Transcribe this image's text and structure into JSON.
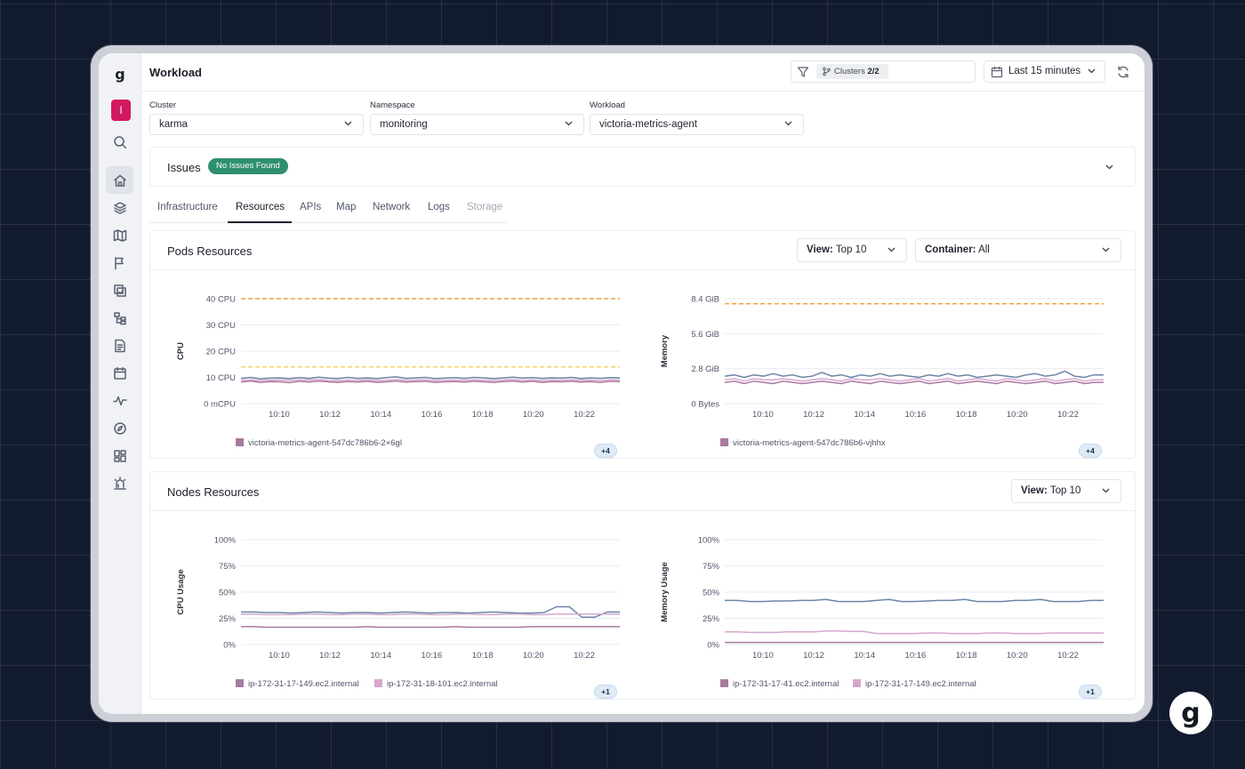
{
  "app": {
    "logo_letter": "g",
    "avatar_letter": "I"
  },
  "sidebar": {
    "icons": [
      "search-icon",
      "home-icon",
      "layers-icon",
      "map-icon",
      "flag-icon",
      "checklist-icon",
      "hierarchy-icon",
      "document-icon",
      "calendar-icon",
      "activity-icon",
      "compass-icon",
      "dashboard-icon",
      "alarm-icon"
    ],
    "active": "home-icon"
  },
  "header": {
    "title": "Workload",
    "clusters_label": "Clusters",
    "clusters_value": "2/2",
    "time_range": "Last 15 minutes"
  },
  "filters": {
    "cluster": {
      "label": "Cluster",
      "value": "karma"
    },
    "namespace": {
      "label": "Namespace",
      "value": "monitoring"
    },
    "workload": {
      "label": "Workload",
      "value": "victoria-metrics-agent"
    }
  },
  "issues": {
    "title": "Issues",
    "badge": "No Issues Found"
  },
  "tabs": [
    {
      "label": "Infrastructure",
      "state": "normal"
    },
    {
      "label": "Resources",
      "state": "active"
    },
    {
      "label": "APIs",
      "state": "normal"
    },
    {
      "label": "Map",
      "state": "normal"
    },
    {
      "label": "Network",
      "state": "normal"
    },
    {
      "label": "Logs",
      "state": "normal"
    },
    {
      "label": "Storage",
      "state": "disabled"
    }
  ],
  "pods_panel": {
    "title": "Pods Resources",
    "view_label": "View:",
    "view_value": "Top 10",
    "container_label": "Container:",
    "container_value": "All"
  },
  "nodes_panel": {
    "title": "Nodes Resources",
    "view_label": "View:",
    "view_value": "Top 10"
  },
  "colors": {
    "series_dark": "#6b86a8",
    "series_mauve": "#a87aa0",
    "series_pink": "#d7a7cf",
    "limit_orange": "#f0a040",
    "limit_yellow": "#f5cf5f",
    "badge_green": "#2e8f71"
  },
  "chart_data": [
    {
      "id": "pods-cpu",
      "type": "line",
      "ylabel": "CPU",
      "y_ticks": [
        "0 mCPU",
        "10 CPU",
        "20 CPU",
        "30 CPU",
        "40 CPU"
      ],
      "ylim": [
        0,
        40
      ],
      "x_ticks": [
        "10:10",
        "10:12",
        "10:14",
        "10:16",
        "10:18",
        "10:20",
        "10:22"
      ],
      "xlim": [
        0,
        14.9
      ],
      "limits": [
        {
          "value": 40,
          "color": "#f0a040"
        },
        {
          "value": 14,
          "color": "#f5cf5f"
        }
      ],
      "series": [
        {
          "color": "#6b86a8",
          "values": [
            9.6,
            10,
            9.4,
            9.7,
            9.8,
            9.5,
            9.9,
            9.6,
            10.1,
            9.7,
            9.5,
            10,
            9.6,
            9.8,
            9.5,
            9.9,
            10.2,
            9.6,
            9.8,
            10,
            9.5,
            9.7,
            9.9,
            9.6,
            10,
            9.8,
            9.5,
            9.8,
            10.1,
            9.7,
            9.9,
            9.6,
            9.8,
            9.7,
            10,
            9.5,
            9.8,
            9.6,
            9.9,
            9.8
          ]
        },
        {
          "color": "#a87aa0",
          "values": [
            8.2,
            8.6,
            8.1,
            8.4,
            8.3,
            8,
            8.5,
            8.2,
            8.6,
            8.3,
            8.1,
            8.4,
            8.2,
            8.5,
            8.1,
            8.3,
            8.6,
            8.2,
            8.4,
            8.5,
            8.1,
            8.3,
            8.4,
            8.2,
            8.5,
            8.3,
            8.1,
            8.4,
            8.6,
            8.2,
            8.5,
            8.1,
            8.4,
            8.3,
            8.5,
            8.2,
            8.4,
            8.1,
            8.5,
            8.4
          ]
        },
        {
          "color": "#d7a7cf",
          "values": [
            8.8,
            9.1,
            8.7,
            8.9,
            9,
            8.8,
            9.1,
            8.9,
            9.2,
            8.8,
            8.7,
            9,
            8.8,
            9.1,
            8.7,
            8.9,
            9.2,
            8.8,
            9,
            9.1,
            8.7,
            8.9,
            9,
            8.8,
            9.1,
            8.9,
            8.7,
            9,
            9.2,
            8.8,
            9.1,
            8.7,
            9,
            8.9,
            9.1,
            8.8,
            9,
            8.7,
            9.1,
            9
          ]
        }
      ],
      "legend": [
        "victoria-metrics-agent-547dc786b6-2×6gl"
      ],
      "more": "+4"
    },
    {
      "id": "pods-memory",
      "type": "line",
      "ylabel": "Memory",
      "y_ticks": [
        "0 Bytes",
        "2.8 GiB",
        "5.6 GiB",
        "8.4 GiB"
      ],
      "ylim": [
        0,
        8.4
      ],
      "x_ticks": [
        "10:10",
        "10:12",
        "10:14",
        "10:16",
        "10:18",
        "10:20",
        "10:22"
      ],
      "xlim": [
        0,
        14.9
      ],
      "limits": [
        {
          "value": 8.0,
          "color": "#f0a040"
        }
      ],
      "series": [
        {
          "color": "#6b86a8",
          "values": [
            2.2,
            2.3,
            2.1,
            2.3,
            2.2,
            2.4,
            2.2,
            2.3,
            2.1,
            2.2,
            2.5,
            2.2,
            2.3,
            2.1,
            2.3,
            2.2,
            2.4,
            2.2,
            2.3,
            2.2,
            2.1,
            2.3,
            2.2,
            2.4,
            2.2,
            2.3,
            2.1,
            2.2,
            2.3,
            2.2,
            2.1,
            2.3,
            2.4,
            2.2,
            2.3,
            2.6,
            2.2,
            2.1,
            2.3,
            2.3
          ]
        },
        {
          "color": "#a87aa0",
          "values": [
            1.7,
            1.8,
            1.6,
            1.8,
            1.7,
            1.6,
            1.8,
            1.7,
            1.6,
            1.7,
            1.8,
            1.7,
            1.6,
            1.8,
            1.7,
            1.6,
            1.8,
            1.7,
            1.6,
            1.7,
            1.8,
            1.6,
            1.7,
            1.8,
            1.6,
            1.7,
            1.8,
            1.7,
            1.6,
            1.8,
            1.7,
            1.6,
            1.7,
            1.8,
            1.6,
            1.7,
            1.8,
            1.6,
            1.7,
            1.7
          ]
        },
        {
          "color": "#d7a7cf",
          "values": [
            1.9,
            2,
            1.8,
            2,
            1.9,
            1.9,
            2,
            1.9,
            1.8,
            1.9,
            2,
            1.9,
            1.8,
            2,
            1.9,
            1.9,
            2,
            1.9,
            1.8,
            1.9,
            2,
            1.8,
            1.9,
            2,
            1.8,
            1.9,
            2,
            1.9,
            1.8,
            2,
            1.9,
            1.8,
            1.9,
            2,
            1.8,
            1.9,
            2,
            1.8,
            1.9,
            1.9
          ]
        }
      ],
      "legend": [
        "victoria-metrics-agent-547dc786b6-vjhhx"
      ],
      "more": "+4"
    },
    {
      "id": "nodes-cpu",
      "type": "line",
      "ylabel": "CPU Usage",
      "y_ticks": [
        "0%",
        "25%",
        "50%",
        "75%",
        "100%"
      ],
      "ylim": [
        0,
        100
      ],
      "x_ticks": [
        "10:10",
        "10:12",
        "10:14",
        "10:16",
        "10:18",
        "10:20",
        "10:22"
      ],
      "xlim": [
        0,
        14.9
      ],
      "limits": [],
      "series": [
        {
          "color": "#6b86a8",
          "values": [
            31,
            31,
            30.5,
            30.5,
            30,
            30.5,
            31,
            30.5,
            30,
            30.5,
            30.5,
            30,
            30.5,
            31,
            30.5,
            30,
            30.5,
            30.5,
            30,
            30.5,
            31,
            30.5,
            30,
            30,
            30.5,
            36,
            36,
            26,
            26,
            31,
            31
          ]
        },
        {
          "color": "#d7a7cf",
          "values": [
            29,
            29,
            28.5,
            28.5,
            28.5,
            29,
            29,
            28.5,
            28.5,
            29,
            29,
            28.5,
            28.5,
            29,
            29,
            28.5,
            28.5,
            29,
            29,
            28.5,
            28.5,
            29,
            29,
            28.5,
            28.5,
            29,
            29,
            29,
            29,
            29,
            29
          ]
        },
        {
          "color": "#a87aa0",
          "values": [
            17,
            17,
            16.5,
            16.5,
            16.5,
            16.5,
            16.5,
            16.5,
            16.5,
            16.5,
            17,
            16.5,
            16.5,
            16.5,
            16.5,
            16.5,
            16.5,
            17,
            16.5,
            16.5,
            16.5,
            16.5,
            16.5,
            17,
            17,
            17,
            17,
            17,
            17,
            17,
            17
          ]
        }
      ],
      "legend": [
        "ip-172-31-17-149.ec2.internal",
        "ip-172-31-18-101.ec2.internal"
      ],
      "more": "+1"
    },
    {
      "id": "nodes-memory",
      "type": "line",
      "ylabel": "Memory Usage",
      "y_ticks": [
        "0%",
        "25%",
        "50%",
        "75%",
        "100%"
      ],
      "ylim": [
        0,
        100
      ],
      "x_ticks": [
        "10:10",
        "10:12",
        "10:14",
        "10:16",
        "10:18",
        "10:20",
        "10:22"
      ],
      "xlim": [
        0,
        14.9
      ],
      "limits": [],
      "series": [
        {
          "color": "#6b86a8",
          "values": [
            42,
            42,
            41,
            41,
            41.5,
            41.5,
            42,
            42,
            43,
            41,
            41,
            41,
            42,
            43,
            41,
            41,
            41.5,
            42,
            42,
            43,
            41,
            41,
            41,
            42,
            42,
            43,
            41,
            41,
            41,
            42,
            42
          ]
        },
        {
          "color": "#d7a7cf",
          "values": [
            12,
            12,
            11.5,
            11.5,
            11.5,
            12,
            12,
            12,
            13,
            13,
            12.5,
            12.5,
            10.5,
            10.5,
            10.5,
            10.5,
            11,
            11,
            10.5,
            10.5,
            10.5,
            11,
            11,
            10.5,
            10.5,
            10.5,
            11,
            11,
            11,
            11,
            11
          ]
        },
        {
          "color": "#a87aa0",
          "values": [
            2,
            2,
            2,
            2,
            2,
            2,
            2,
            2,
            2,
            2,
            2,
            2,
            2,
            2,
            2,
            2,
            2,
            2,
            2,
            2,
            2,
            2,
            2,
            2,
            2,
            2,
            2,
            2,
            2,
            2,
            2
          ]
        }
      ],
      "legend": [
        "ip-172-31-17-41.ec2.internal",
        "ip-172-31-17-149.ec2.internal"
      ],
      "more": "+1"
    }
  ]
}
